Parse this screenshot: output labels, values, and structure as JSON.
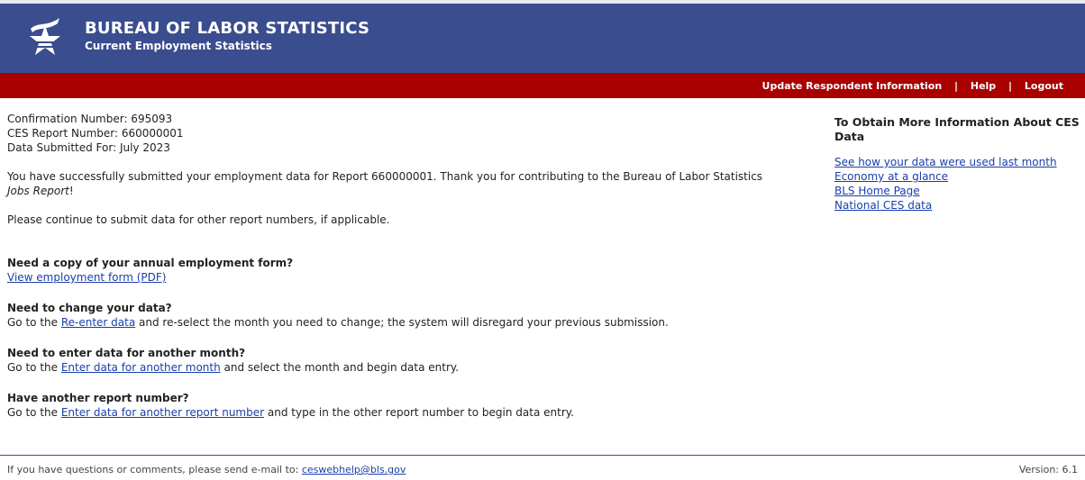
{
  "header": {
    "agency": "BUREAU OF LABOR STATISTICS",
    "program": "Current Employment Statistics",
    "logo_icon": "bls-star-logo-icon",
    "bg_color": "#3a4d8f"
  },
  "nav": {
    "bar_color": "#a90000",
    "items": [
      "Update Respondent Information",
      "Help",
      "Logout"
    ]
  },
  "confirmation": {
    "confirmation_number": "Confirmation Number: 695093",
    "report_number": "CES Report Number: 660000001",
    "data_submitted": "Data Submitted For: July 2023"
  },
  "message": {
    "success_text": "You have successfully submitted your employment data for Report 660000001. Thank you for contributing to the Bureau of Labor Statistics",
    "success_italic": "Jobs Report",
    "success_end": "!",
    "continue_text": "Please continue to submit data for other report numbers, if applicable."
  },
  "sections": {
    "copy": {
      "question": "Need a copy of your annual employment form?",
      "link": "View employment form (PDF)"
    },
    "change": {
      "question": "Need to change your data?",
      "pre": "Go to the ",
      "link": "Re-enter data",
      "post": " and re-select the month you need to change; the system will disregard your previous submission."
    },
    "month": {
      "question": "Need to enter data for another month?",
      "pre": "Go to the ",
      "link": "Enter data for another month",
      "post": " and select the month and begin data entry."
    },
    "report": {
      "question": "Have another report number?",
      "pre": "Go to the ",
      "link": "Enter data for another report number",
      "post": " and type in the other report number to begin data entry."
    }
  },
  "sidebar": {
    "title": "To Obtain More Information About CES Data",
    "links": [
      "See how your data were used last month",
      "Economy at a glance",
      "BLS Home Page",
      "National CES data"
    ]
  },
  "footer": {
    "text": "If you have questions or comments, please send e-mail to: ",
    "email": "ceswebhelp@bls.gov",
    "version": "Version: 6.1"
  }
}
